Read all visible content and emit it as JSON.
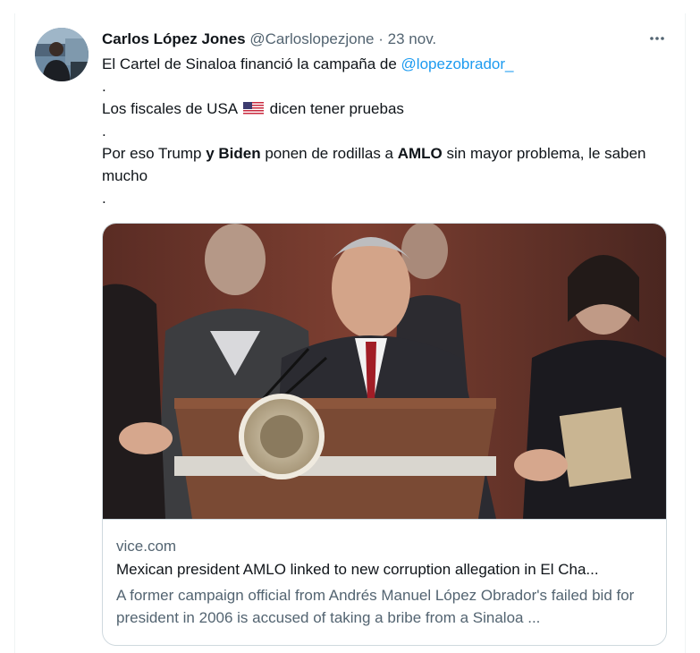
{
  "tweet": {
    "display_name": "Carlos López Jones",
    "handle": "@Carloslopezjone",
    "separator": "·",
    "time": "23 nov.",
    "more_icon": "more-horizontal-icon",
    "lines": {
      "l1_text": "El Cartel de Sinaloa financió la campaña de ",
      "l1_mention": "@lopezobrador_",
      "dot1": ".",
      "l2_before": "Los fiscales de USA ",
      "l2_flag": "us-flag-emoji",
      "l2_after": " dicen tener pruebas",
      "dot2": ".",
      "l3_a": "Por eso Trump ",
      "l3_b": "y Biden",
      "l3_c": " ponen de rodillas a ",
      "l3_d": "AMLO",
      "l3_e": " sin mayor problema, le saben mucho",
      "dot3": "."
    }
  },
  "card": {
    "domain": "vice.com",
    "title": "Mexican president AMLO linked to new corruption allegation in El Cha...",
    "description": "A former campaign official from Andrés Manuel López Obrador's failed bid for president in 2006 is accused of taking a bribe from a Sinaloa ...",
    "image_alt": "man-speaking-at-podium-photo"
  },
  "colors": {
    "text": "#0f1419",
    "secondary": "#536471",
    "link": "#1d9bf0",
    "border": "#cfd9de"
  }
}
